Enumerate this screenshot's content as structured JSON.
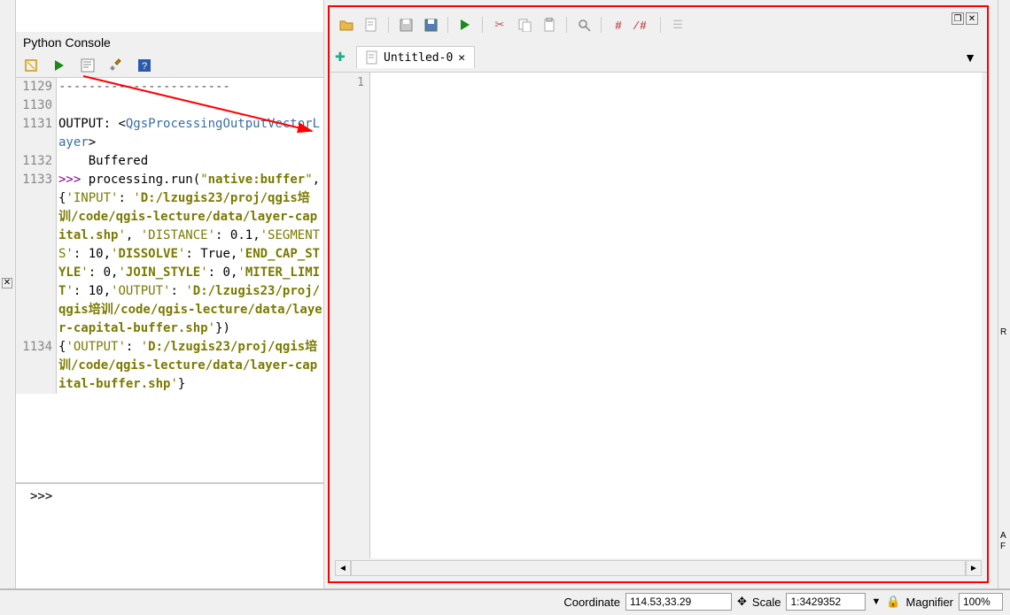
{
  "console": {
    "title": "Python Console",
    "toolbar": [
      "clear",
      "run",
      "editor",
      "settings",
      "help"
    ],
    "input_prompt": ">>>",
    "lines": [
      {
        "n": 1129,
        "html": "<span class='tk-dash'>-----------------------</span>"
      },
      {
        "n": 1130,
        "html": ""
      },
      {
        "n": 1131,
        "html": "<span class='tk-key'>OUTPUT:</span> &lt;<span class='tk-tag'>QgsProcessingOutputVectorLayer</span>&gt;"
      },
      {
        "n": 1132,
        "html": "    <span class='tk-ident'>Buffered</span>"
      },
      {
        "n": 1133,
        "html": "<span class='tk-prompt'>&gt;&gt;&gt;</span> <span class='tk-ident'>processing.run</span>(<span class='tk-str'>\"</span><span class='tk-strb'>native:buffer</span><span class='tk-str'>\"</span>, {<span class='tk-str'>'INPUT'</span>: <span class='tk-str'>'</span><span class='tk-strb'>D:/lzugis23/proj/qgis培训/code/qgis-lecture/data/layer-capital.shp</span><span class='tk-str'>'</span>, <span class='tk-str'>'DISTANCE'</span>: <span class='tk-num'>0.1</span>,<span class='tk-str'>'SEGMENTS'</span>: <span class='tk-num'>10</span>,<span class='tk-str'>'</span><span class='tk-strb'>DISSOLVE</span><span class='tk-str'>'</span>: <span class='tk-bool'>True</span>,<span class='tk-str'>'</span><span class='tk-strb'>END_CAP_STYLE</span><span class='tk-str'>'</span>: <span class='tk-num'>0</span>,<span class='tk-str'>'</span><span class='tk-strb'>JOIN_STYLE</span><span class='tk-str'>'</span>: <span class='tk-num'>0</span>,<span class='tk-str'>'</span><span class='tk-strb'>MITER_LIMIT</span><span class='tk-str'>'</span>: <span class='tk-num'>10</span>,<span class='tk-str'>'OUTPUT'</span>: <span class='tk-str'>'</span><span class='tk-strb'>D:/lzugis23/proj/qgis培训/code/qgis-lecture/data/layer-capital-buffer.shp</span><span class='tk-str'>'</span>})"
      },
      {
        "n": 1134,
        "html": "{<span class='tk-str'>'OUTPUT'</span>: <span class='tk-str'>'</span><span class='tk-strb'>D:/lzugis23/proj/qgis培训/code/qgis-lecture/data/layer-capital-buffer.shp</span><span class='tk-str'>'</span>}"
      }
    ]
  },
  "editor": {
    "tab_label": "Untitled-0",
    "first_line_no": "1",
    "toolbar_icons": [
      "open",
      "new",
      "save",
      "saveas",
      "run",
      "cut",
      "copy",
      "paste",
      "find",
      "comment",
      "uncomment",
      "objinspect"
    ]
  },
  "status": {
    "coord_label": "Coordinate",
    "coord_value": "114.53,33.29",
    "scale_label": "Scale",
    "scale_value": "1:3429352",
    "mag_label": "Magnifier",
    "mag_value": "100%"
  }
}
